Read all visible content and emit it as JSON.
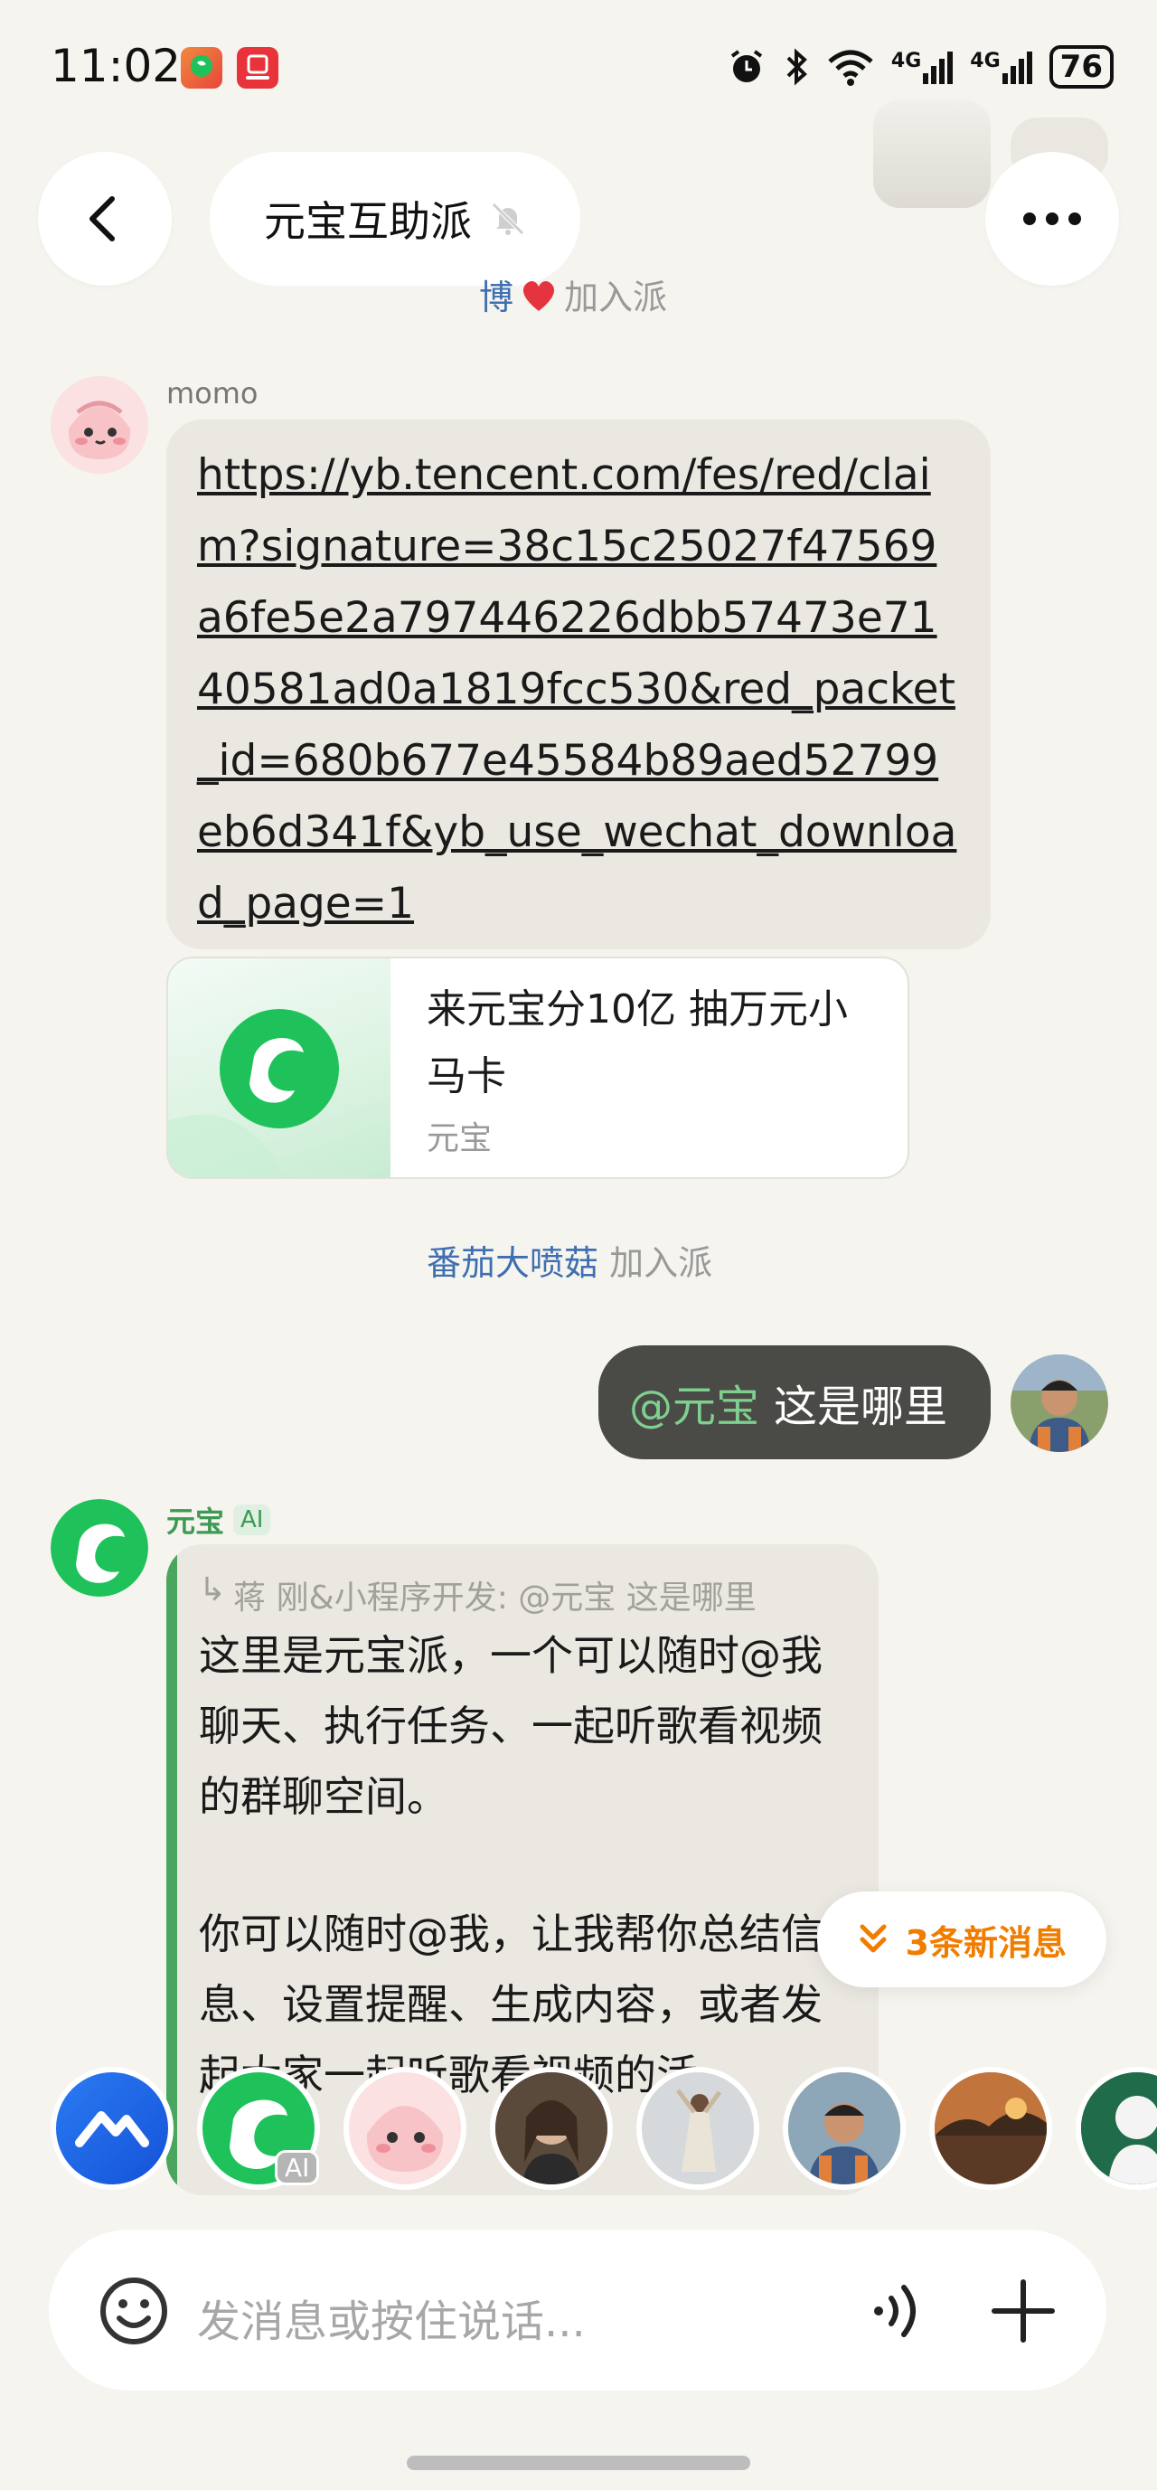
{
  "status_bar": {
    "time": "11:02",
    "network_1": "4G",
    "network_2": "4G",
    "battery": "76"
  },
  "header": {
    "back_icon": "chevron-left-icon",
    "group_name": "元宝互助派",
    "mute_icon": "bell-off-icon",
    "more_icon": "more-horizontal-icon"
  },
  "messages": {
    "top_join": {
      "name": "博",
      "action": "加入派"
    },
    "momo": {
      "sender": "momo",
      "link": "https://yb.tencent.com/fes/red/claim?signature=38c15c25027f47569a6fe5e2a797446226dbb57473e7140581ad0a1819fcc530&red_packet_id=680b677e45584b89aed52799eb6d341f&yb_use_wechat_download_page=1",
      "card": {
        "title": "来元宝分10亿 抽万元小马卡",
        "source": "元宝"
      }
    },
    "join2": {
      "name": "番茄大喷菇",
      "action": "加入派"
    },
    "mine": {
      "mention": "@元宝",
      "text": "这是哪里"
    },
    "ai_reply": {
      "sender": "元宝",
      "badge": "AI",
      "quote": "蒋 刚&小程序开发: @元宝 这是哪里",
      "para1": "这里是元宝派，一个可以随时@我聊天、执行任务、一起听歌看视频的群聊空间。",
      "para2": "你可以随时@我，让我帮你总结信息、设置提醒、生成内容，或者发起大家一起听歌看视频的活"
    }
  },
  "new_messages_pill": {
    "label": "3条新消息",
    "icon": "chevrons-down-icon"
  },
  "members_row": {
    "ai_badge": "AI"
  },
  "input": {
    "placeholder": "发消息或按住说话...",
    "emoji_icon": "smile-icon",
    "voice_icon": "voice-wave-icon",
    "plus_icon": "plus-icon"
  },
  "colors": {
    "background": "#f5f4ef",
    "bubble": "#eae8e1",
    "my_bubble": "#4a4a46",
    "accent_green": "#20c05c",
    "link_blue": "#3f6fb0",
    "orange": "#f07d00"
  }
}
